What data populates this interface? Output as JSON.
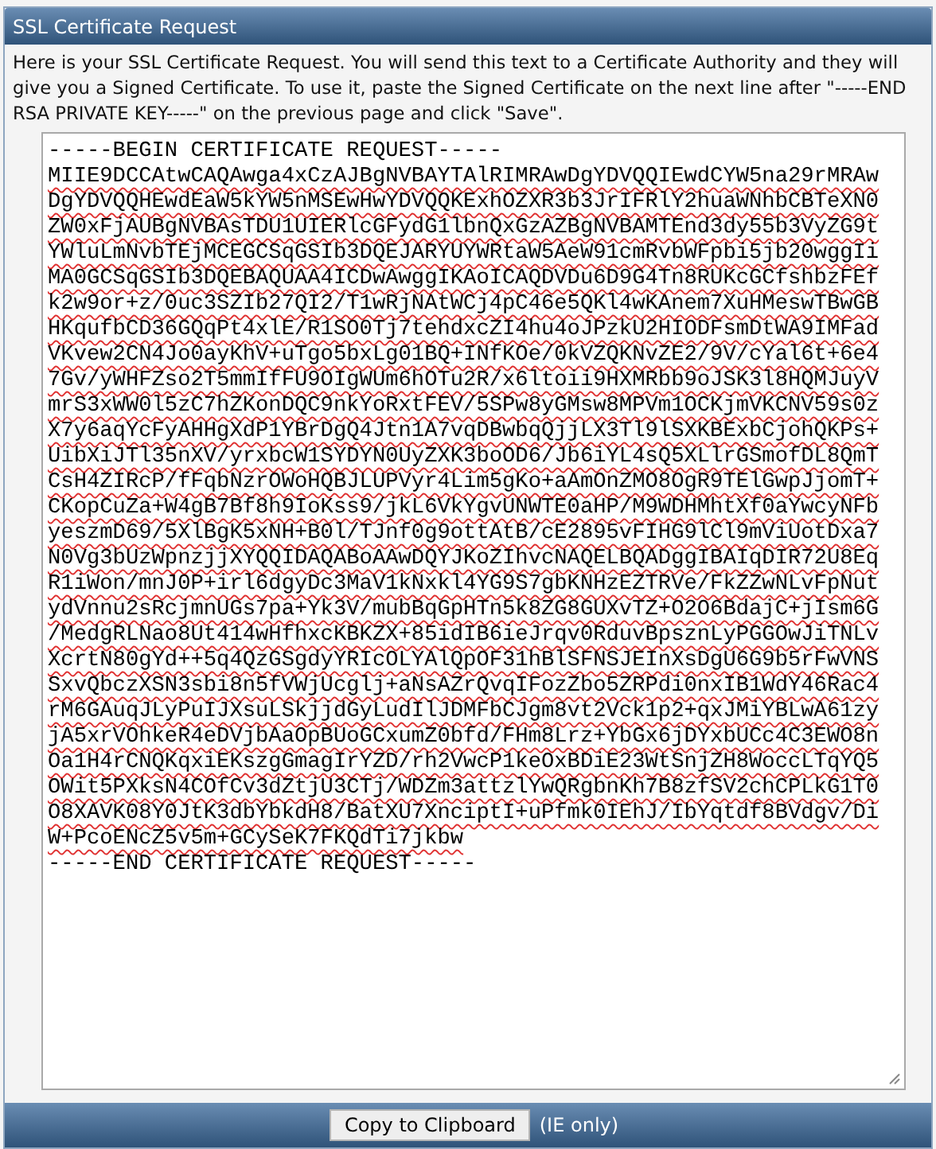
{
  "panel": {
    "title": "SSL Certificate Request"
  },
  "intro": "Here is your SSL Certificate Request. You will send this text to a Certificate Authority and they will give you a Signed Certificate. To use it, paste the Signed Certificate on the next line after \"-----END RSA PRIVATE KEY-----\" on the previous page and click \"Save\".",
  "certificate": {
    "lines": [
      {
        "text": "-----BEGIN CERTIFICATE REQUEST-----",
        "misspelled": false
      },
      {
        "text": "MIIE9DCCAtwCAQAwga4xCzAJBgNVBAYTAlRIMRAwDgYDVQQIEwdCYW5na29rMRAw",
        "misspelled": true
      },
      {
        "text": "DgYDVQQHEwdEaW5kYW5nMSEwHwYDVQQKExhOZXR3b3JrIFRlY2huaWNhbCBTeXN0",
        "misspelled": true
      },
      {
        "text": "ZW0xFjAUBgNVBAsTDU1UIERlcGFydG1lbnQxGzAZBgNVBAMTEnd3dy55b3VyZG9t",
        "misspelled": true
      },
      {
        "text": "YWluLmNvbTEjMCEGCSqGSIb3DQEJARYUYWRtaW5AeW91cmRvbWFpbi5jb20wggIi",
        "misspelled": true
      },
      {
        "text": "MA0GCSqGSIb3DQEBAQUAA4ICDwAwggIKAoICAQDVDu6D9G4Tn8RUKcGCfshbzFEf",
        "misspelled": true
      },
      {
        "text": "k2w9or+z/0uc3SZIb27QI2/T1wRjNAtWCj4pC46e5QKl4wKAnem7XuHMeswTBwGB",
        "misspelled": true
      },
      {
        "text": "HKqufbCD36GQqPt4xlE/R1SO0Tj7tehdxcZI4hu4oJPzkU2HIODFsmDtWA9IMFad",
        "misspelled": true
      },
      {
        "text": "VKvew2CN4Jo0ayKhV+uTgo5bxLg01BQ+INfKOe/0kVZQKNvZE2/9V/cYal6t+6e4",
        "misspelled": true
      },
      {
        "text": "7Gv/yWHFZso2T5mmIfFU9OIgWUm6hOTu2R/x6ltoii9HXMRbb9oJSK3l8HQMJuyV",
        "misspelled": true
      },
      {
        "text": "mrS3xWW0l5zC7hZKonDQC9nkYoRxtFEV/5SPw8yGMsw8MPVm1OCKjmVKCNV59s0z",
        "misspelled": true
      },
      {
        "text": "X7y6aqYcFyAHHgXdP1YBrDgQ4Jtn1A7vqDBwbqQjjLX3Tl9lSXKBExbCjohQKPs+",
        "misspelled": true
      },
      {
        "text": "UibXiJTl35nXV/yrxbcW1SYDYN0UyZXK3boOD6/Jb6iYL4sQ5XLlrGSmofDL8QmT",
        "misspelled": true
      },
      {
        "text": "CsH4ZIRcP/fFqbNzrOWoHQBJLUPVyr4Lim5gKo+aAmOnZMO8OgR9TElGwpJjomT+",
        "misspelled": true
      },
      {
        "text": "CKopCuZa+W4gB7Bf8h9IoKss9/jkL6VkYgvUNWTE0aHP/M9WDHMhtXf0aYwcyNFb",
        "misspelled": true
      },
      {
        "text": "yeszmD69/5XlBgK5xNH+B0l/TJnf0g9ottAtB/cE2895vFIHG9lCl9mViUotDxa7",
        "misspelled": true
      },
      {
        "text": "N0Vg3bUzWpnzjjXYQQIDAQABoAAwDQYJKoZIhvcNAQELBQADggIBAIqDIR72U8Eq",
        "misspelled": true
      },
      {
        "text": "R1iWon/mnJ0P+irl6dgyDc3MaV1kNxkl4YG9S7gbKNHzEZTRVe/FkZZwNLvFpNut",
        "misspelled": true
      },
      {
        "text": "ydVnnu2sRcjmnUGs7pa+Yk3V/mubBqGpHTn5k8ZG8GUXvTZ+O2O6BdajC+jIsm6G",
        "misspelled": true
      },
      {
        "text": "/MedgRLNao8Ut414wHfhxcKBKZX+85idIB6ieJrqv0RduvBpsznLyPGGOwJiTNLv",
        "misspelled": true
      },
      {
        "text": "XcrtN80gYd++5q4QzGSgdyYRIcOLYAlQpOF31hBlSFNSJEInXsDgU6G9b5rFwVNS",
        "misspelled": true
      },
      {
        "text": "SxvQbczXSN3sbi8n5fVWjUcglj+aNsAZrQvqIFozZbo5ZRPdi0nxIB1WdY46Rac4",
        "misspelled": true
      },
      {
        "text": "rM6GAuqJLyPuIJXsuLSkjjdGyLudIlJDMFbCJgm8vt2Vck1p2+qxJMiYBLwA61zy",
        "misspelled": true
      },
      {
        "text": "jA5xrVOhkeR4eDVjbAaOpBUoGCxumZ0bfd/FHm8Lrz+YbGx6jDYxbUCc4C3EWO8n",
        "misspelled": true
      },
      {
        "text": "Oa1H4rCNQKqxiEKszgGmagIrYZD/rh2VwcP1keOxBDiE23WtSnjZH8WoccLTqYQ5",
        "misspelled": true
      },
      {
        "text": "OWit5PXksN4COfCv3dZtjU3CTj/WDZm3attzlYwQRgbnKh7B8zfSV2chCPLkG1T0",
        "misspelled": true
      },
      {
        "text": "O8XAVK08Y0JtK3dbYbkdH8/BatXU7XnciptI+uPfmk0IEhJ/IbYqtdf8BVdgv/Di",
        "misspelled": true
      },
      {
        "text": "W+PcoENcZ5v5m+GCySeK7FKQdTi7jkbw",
        "misspelled": true
      },
      {
        "text": "-----END CERTIFICATE REQUEST-----",
        "misspelled": false
      }
    ]
  },
  "footer": {
    "button": "Copy to Clipboard",
    "note": "(IE only)"
  }
}
